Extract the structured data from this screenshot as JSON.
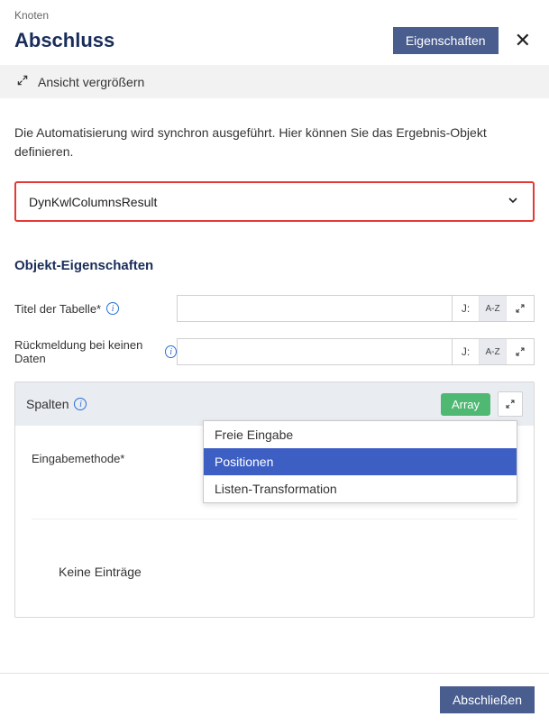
{
  "header": {
    "breadcrumb": "Knoten",
    "title": "Abschluss",
    "properties_btn": "Eigenschaften"
  },
  "expand_bar": {
    "label": "Ansicht vergrößern"
  },
  "description": "Die Automatisierung wird synchron ausgeführt. Hier können Sie das Ergebnis-Objekt definieren.",
  "result_select": {
    "value": "DynKwlColumnsResult"
  },
  "section_title": "Objekt-Eigenschaften",
  "props": {
    "title_label": "Titel der Tabelle*",
    "feedback_label": "Rückmeldung bei keinen Daten",
    "j_label": "J:",
    "az_label": "A-Z"
  },
  "spalten": {
    "header": "Spalten",
    "array_badge": "Array",
    "method_label": "Eingabemethode*",
    "method_value": "Positionen",
    "options": [
      "Freie Eingabe",
      "Positionen",
      "Listen-Transformation"
    ],
    "selected_index": 1,
    "no_entries": "Keine Einträge"
  },
  "footer": {
    "close": "Abschließen"
  }
}
